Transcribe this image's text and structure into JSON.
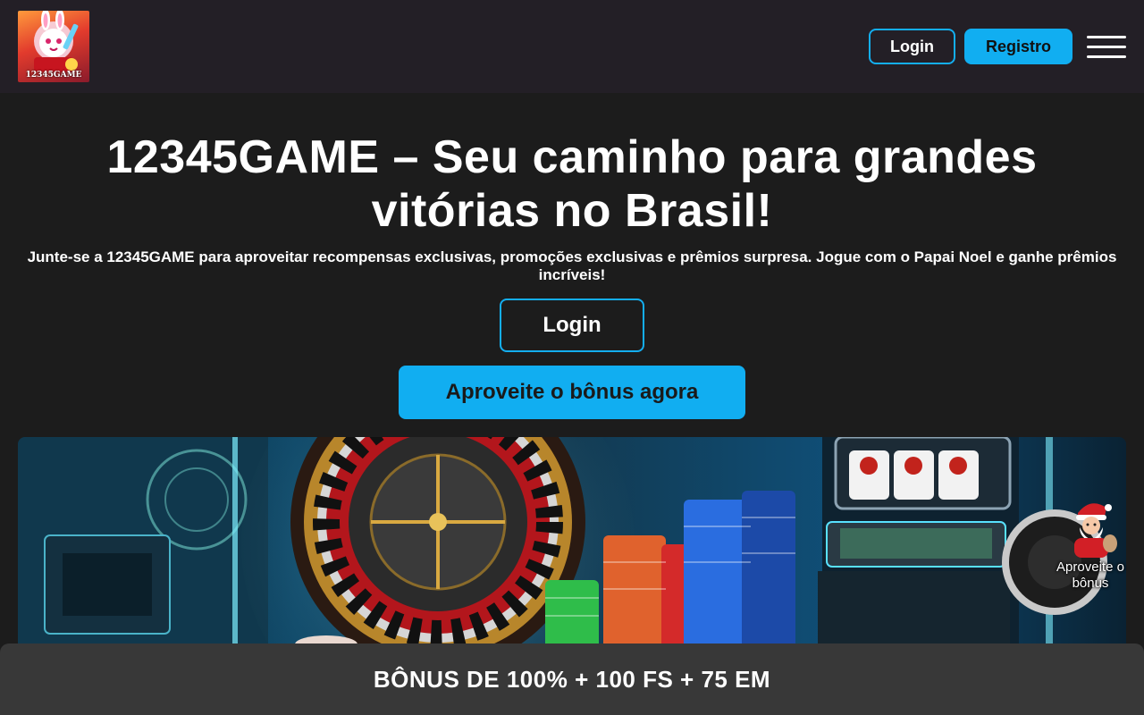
{
  "header": {
    "logo_text": "12345GAME",
    "login_label": "Login",
    "register_label": "Registro",
    "menu_icon": "hamburger-menu-icon"
  },
  "hero": {
    "title": "12345GAME – Seu caminho para grandes vitórias no Brasil!",
    "subtitle": "Junte-se a 12345GAME para aproveitar recompensas exclusivas, promoções exclusivas e prêmios surpresa. Jogue com o Papai Noel e ganhe prêmios incríveis!",
    "login_label": "Login",
    "bonus_label": "Aproveite o bônus agora"
  },
  "banner": {
    "image": "casino-roulette-slots-banner"
  },
  "float_bonus": {
    "icon": "santa-claus-icon",
    "label": "Aproveite o bônus"
  },
  "bottom_bar": {
    "text": "BÔNUS DE 100% + 100 FS + 75 EM"
  },
  "colors": {
    "accent": "#11aef1",
    "header_bg": "#231f26",
    "page_bg": "#1c1c1c",
    "bottom_bar_bg": "#383838"
  }
}
